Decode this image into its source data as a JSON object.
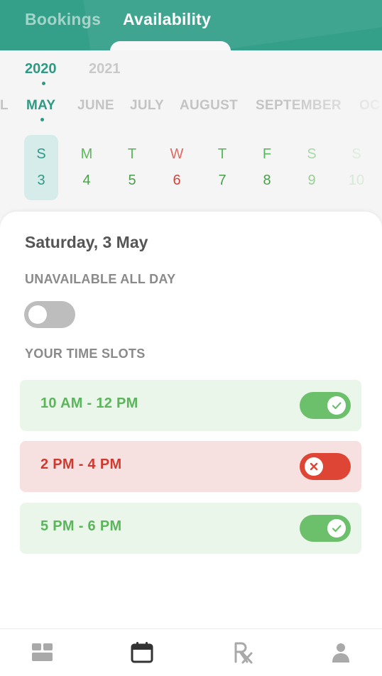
{
  "header": {
    "tabs": [
      {
        "label": "Bookings",
        "active": false
      },
      {
        "label": "Availability",
        "active": true
      }
    ]
  },
  "years": [
    {
      "label": "2020",
      "selected": true
    },
    {
      "label": "2021",
      "selected": false
    }
  ],
  "months": [
    {
      "label": "L"
    },
    {
      "label": "MAY",
      "selected": true
    },
    {
      "label": "JUNE"
    },
    {
      "label": "JULY"
    },
    {
      "label": "AUGUST"
    },
    {
      "label": "SEPTEMBER"
    },
    {
      "label": "OC"
    }
  ],
  "days": [
    {
      "letter": "S",
      "num": "3",
      "selected": true
    },
    {
      "letter": "M",
      "num": "4"
    },
    {
      "letter": "T",
      "num": "5"
    },
    {
      "letter": "W",
      "num": "6"
    },
    {
      "letter": "T",
      "num": "7"
    },
    {
      "letter": "F",
      "num": "8"
    },
    {
      "letter": "S",
      "num": "9"
    },
    {
      "letter": "S",
      "num": "10"
    }
  ],
  "card": {
    "date_title": "Saturday, 3 May",
    "unavailable_label": "UNAVAILABLE ALL DAY",
    "unavailable_on": false,
    "slots_label": "YOUR TIME SLOTS",
    "slots": [
      {
        "label": "10 AM - 12 PM",
        "available": true
      },
      {
        "label": "2 PM - 4 PM",
        "available": false
      },
      {
        "label": "5 PM - 6 PM",
        "available": true
      }
    ]
  },
  "colors": {
    "primary": "#34a08a",
    "available": "#6cc06c",
    "unavailable": "#de4535",
    "weekday_green": "#4caf50",
    "wednesday_red": "#d9534f"
  },
  "nav": [
    {
      "icon": "dashboard-icon",
      "active": false
    },
    {
      "icon": "calendar-icon",
      "active": true
    },
    {
      "icon": "prescription-icon",
      "active": false
    },
    {
      "icon": "profile-icon",
      "active": false
    }
  ]
}
